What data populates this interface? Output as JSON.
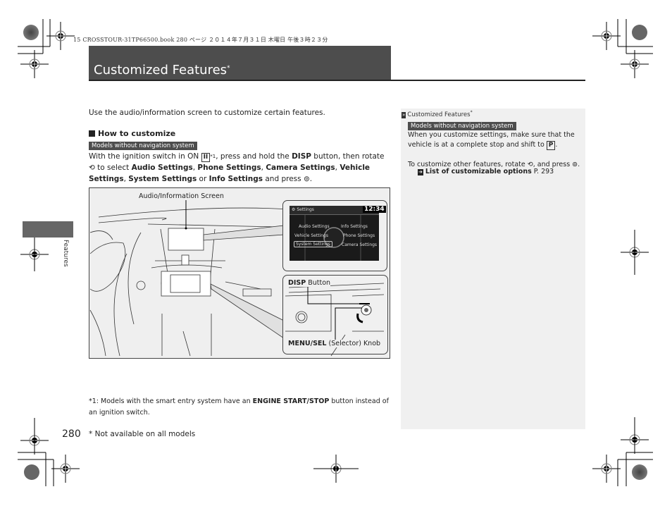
{
  "print_header": "15 CROSSTOUR-31TP66500.book  280 ページ  ２０１４年７月３１日  木曜日  午後３時２３分",
  "page": {
    "title": "Customized Features",
    "title_marker": "*",
    "side_tab_label": "Features",
    "page_number": "280",
    "not_available_note": "* Not available on all models"
  },
  "main": {
    "intro": "Use the audio/information screen to customize certain features.",
    "section_heading": "How to customize",
    "model_badge": "Models without navigation system",
    "instructions": {
      "p1": "With the ignition switch in ON ",
      "ignition_key": "II",
      "footnote_ref": "*1",
      "p2": ", press and hold the ",
      "disp": "DISP",
      "p3": " button, then rotate ",
      "knob_icon": "selector-knob-rotate-icon",
      "p4": " to select ",
      "options": [
        "Audio Settings",
        "Phone Settings",
        "Camera Settings",
        "Vehicle Settings",
        "System Settings",
        "Info Settings"
      ],
      "sep": ", ",
      "or": " or ",
      "p5": " and press ",
      "press_icon": "selector-knob-press-icon",
      "end": "."
    },
    "figure": {
      "screen_label": "Audio/Information Screen",
      "disp_label_bold": "DISP",
      "disp_label_rest": " Button",
      "knob_label_bold": "MENU/SEL",
      "knob_label_rest": " (Selector) Knob",
      "screen": {
        "header": "Settings",
        "clock": "12:34",
        "items": [
          "Audio Settings",
          "Info Settings",
          "Vehicle Settings",
          "Phone Settings",
          "System Settings",
          "Camera Settings"
        ],
        "selected": "System Settings"
      }
    },
    "footnote": {
      "p1": "*1: Models with the smart entry system have an ",
      "bold": "ENGINE START/STOP",
      "p2": " button instead of an ignition switch."
    }
  },
  "sidebar": {
    "heading": "Customized Features",
    "heading_marker": "*",
    "model_badge": "Models without navigation system",
    "text1": "When you customize settings, make sure that the vehicle is at a complete stop and shift to ",
    "park_key": "P",
    "text1_end": ".",
    "text2_a": "To customize other features, rotate ",
    "text2_b": ", and press ",
    "text2_end": ".",
    "link_label": "List of customizable options",
    "link_page": "P. 293"
  }
}
